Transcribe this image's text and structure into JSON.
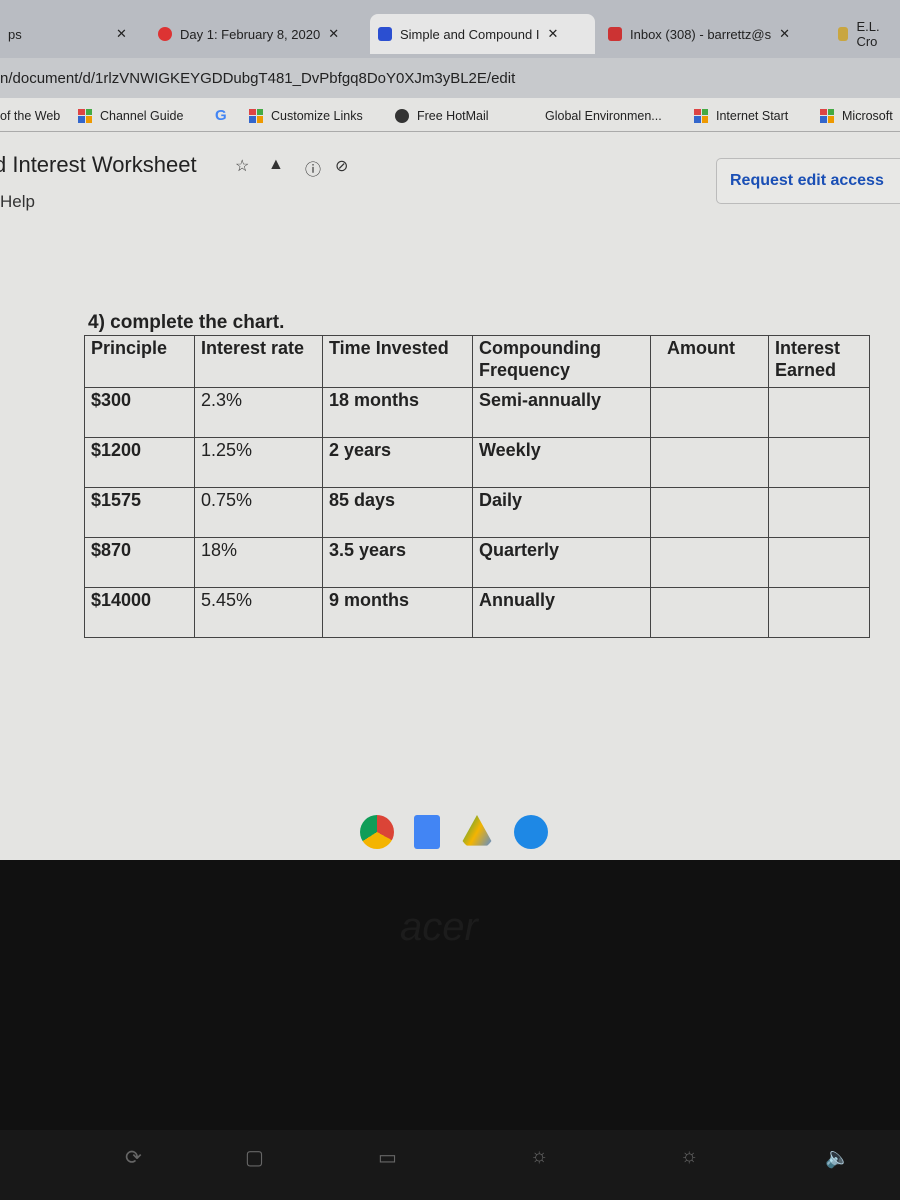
{
  "browser": {
    "tabs": [
      {
        "label": "ps",
        "active": false
      },
      {
        "label": "Day 1: February 8, 2020",
        "active": false
      },
      {
        "label": "Simple and Compound I",
        "active": true
      },
      {
        "label": "Inbox (308) - barrettz@s",
        "active": false
      },
      {
        "label": "E.L. Cro",
        "active": false
      }
    ],
    "url": "n/document/d/1rlzVNWIGKEYGDDubgT481_DvPbfgq8DoY0XJm3yBL2E/edit",
    "bookmarks": [
      "of the Web",
      "Channel Guide",
      "G",
      "Customize Links",
      "Free HotMail",
      "Global Environmen...",
      "Internet Start",
      "Microsoft"
    ]
  },
  "doc": {
    "title": "d Interest Worksheet",
    "menu_help": "Help",
    "request_edit": "Request edit access",
    "question": "4) complete the chart.",
    "table": {
      "headers": [
        "Principle",
        "Interest rate",
        "Time Invested",
        "Compounding Frequency",
        "Amount",
        "Interest Earned"
      ],
      "rows": [
        [
          "$300",
          "2.3%",
          "18 months",
          "Semi-annually",
          "",
          ""
        ],
        [
          "$1200",
          "1.25%",
          "2 years",
          "Weekly",
          "",
          ""
        ],
        [
          "$1575",
          "0.75%",
          "85 days",
          "Daily",
          "",
          ""
        ],
        [
          "$870",
          "18%",
          "3.5 years",
          "Quarterly",
          "",
          ""
        ],
        [
          "$14000",
          "5.45%",
          "9 months",
          "Annually",
          "",
          ""
        ]
      ]
    }
  },
  "shelf": [
    "chrome",
    "docs",
    "drive",
    "play"
  ],
  "laptop_brand": "acer",
  "colors": {
    "accent": "#1a4fb5",
    "tabbar": "#b9bcc2"
  }
}
